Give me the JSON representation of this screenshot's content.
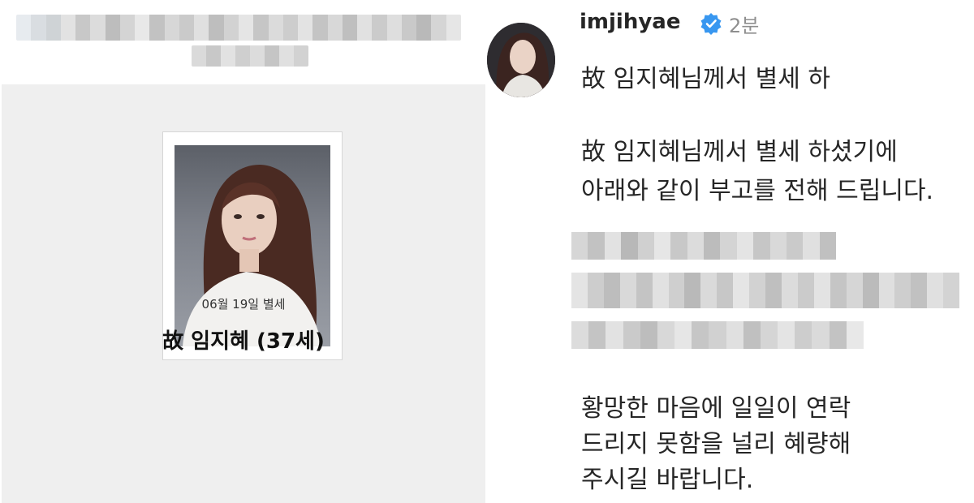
{
  "obituary": {
    "death_date": "06월 19일 별세",
    "deceased_name": "故 임지혜 (37세)"
  },
  "post": {
    "username": "imjihyae",
    "time_ago": "2분",
    "caption_lines": [
      "故 임지혜님께서 별세 하",
      "故 임지혜님께서 별세 하셨기에",
      "아래와 같이 부고를 전해 드립니다.",
      "황망한 마음에 일일이 연락",
      "드리지 못함을 널리 혜량해",
      "주시길 바랍니다."
    ],
    "verified_color": "#3897f0"
  }
}
